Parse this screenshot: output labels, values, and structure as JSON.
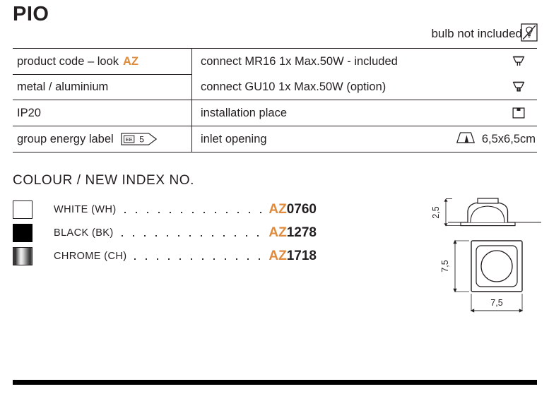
{
  "header": {
    "title": "PIO",
    "notice_text": "bulb not included",
    "notice_icon": "bulb-crossed-out-icon"
  },
  "accent_color": "#e08a3c",
  "spec_table": {
    "rows": [
      {
        "left_label": "product code – look",
        "left_accent": "AZ",
        "right_label": "connect MR16 1x Max.50W - included",
        "right_icon": "mr16-bulb-icon"
      },
      {
        "left_label": "metal / aluminium",
        "left_accent": "",
        "right_label": "connect GU10 1x Max.50W (option)",
        "right_icon": "gu10-bulb-icon"
      },
      {
        "left_label": "IP20",
        "left_accent": "",
        "right_label": "installation place",
        "right_icon": "recessed-ceiling-icon"
      },
      {
        "left_label": "group energy label",
        "left_badge": {
          "prefix": "EE",
          "value": "5"
        },
        "right_label": "inlet opening",
        "right_icon": "inlet-opening-icon",
        "right_value": "6,5x6,5cm"
      }
    ]
  },
  "colour_section": {
    "heading": "COLOUR / NEW INDEX NO.",
    "items": [
      {
        "swatch": "white",
        "name": "WHITE (WH)",
        "code_prefix": "AZ",
        "code_number": "0760"
      },
      {
        "swatch": "black",
        "name": "BLACK (BK)",
        "code_prefix": "AZ",
        "code_number": "1278"
      },
      {
        "swatch": "chrome",
        "name": "CHROME (CH)",
        "code_prefix": "AZ",
        "code_number": "1718"
      }
    ]
  },
  "drawing": {
    "height_label": "2,5",
    "depth_label": "7,5",
    "width_label": "7,5"
  }
}
